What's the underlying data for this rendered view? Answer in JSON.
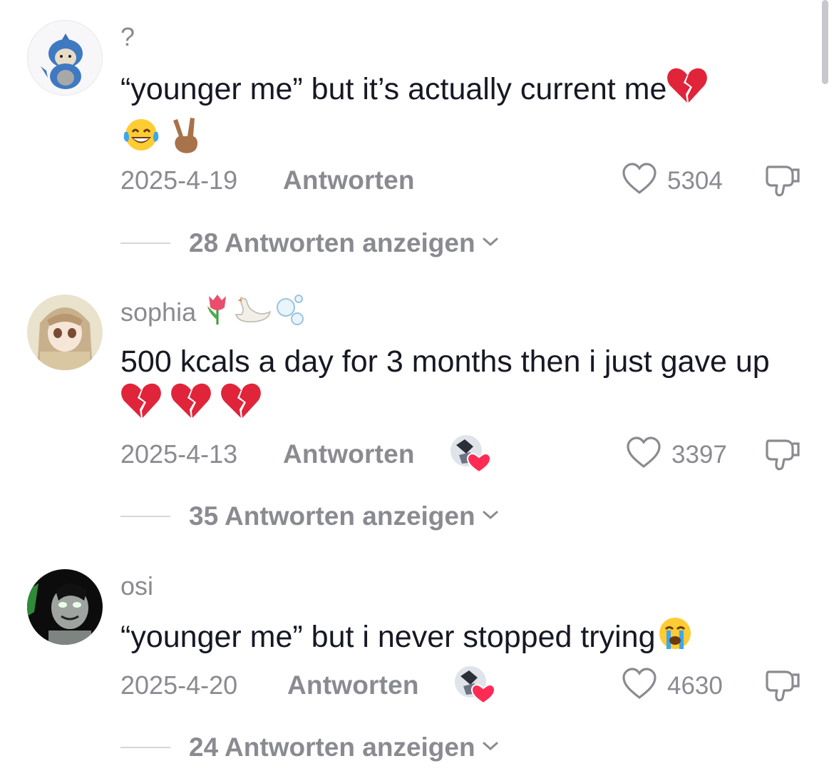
{
  "comments": [
    {
      "username": "?",
      "text": "“younger me” but it’s actually current me",
      "text_emojis": [
        "broken-heart",
        "tears-of-joy",
        "victory-hand"
      ],
      "date": "2025-4-19",
      "reply_label": "Antworten",
      "likes": "5304",
      "creator_liked": false,
      "replies_label": "28 Antworten anzeigen"
    },
    {
      "username": "sophia",
      "username_emojis": [
        "tulip",
        "swan",
        "bubbles"
      ],
      "text": "500 kcals a day for 3 months then i just gave up",
      "text_emojis": [
        "broken-heart",
        "broken-heart",
        "broken-heart"
      ],
      "date": "2025-4-13",
      "reply_label": "Antworten",
      "likes": "3397",
      "creator_liked": true,
      "replies_label": "35 Antworten anzeigen"
    },
    {
      "username": "osi",
      "text": "“younger me” but i never stopped trying",
      "text_emojis": [
        "loudly-crying-face"
      ],
      "date": "2025-4-20",
      "reply_label": "Antworten",
      "likes": "4630",
      "creator_liked": true,
      "replies_label": "24 Antworten anzeigen"
    }
  ],
  "colors": {
    "text": "#161823",
    "muted": "#8a8b91",
    "heart_red": "#fe2c55"
  }
}
